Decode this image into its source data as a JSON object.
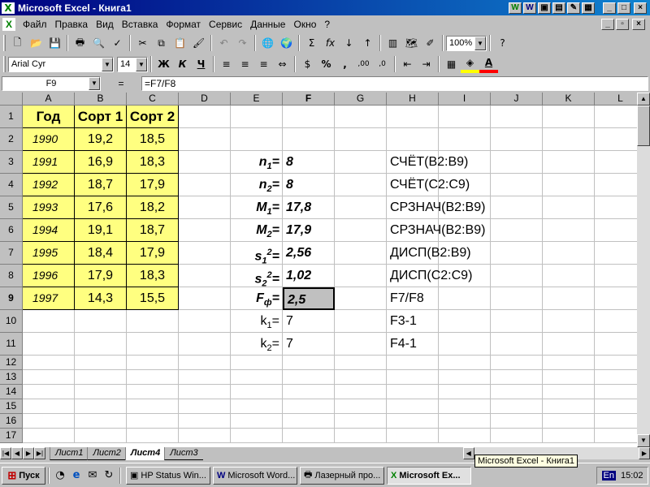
{
  "window": {
    "title": "Microsoft Excel - Книга1",
    "app_icon": "X",
    "ql_icons": [
      "W",
      "W",
      "▣",
      "▤",
      "✎",
      "▦"
    ],
    "min_label": "_",
    "max_label": "□",
    "close_label": "×",
    "doc_min_label": "_",
    "doc_max_label": "▫",
    "doc_close_label": "×"
  },
  "menu": [
    "Файл",
    "Правка",
    "Вид",
    "Вставка",
    "Формат",
    "Сервис",
    "Данные",
    "Окно",
    "?"
  ],
  "toolbar_standard": {
    "icons": [
      "new-icon",
      "open-icon",
      "save-icon",
      "print-icon",
      "preview-icon",
      "spell-icon",
      "cut-icon",
      "copy-icon",
      "paste-icon",
      "format-painter-icon",
      "undo-icon",
      "redo-icon",
      "hyperlink-icon",
      "web-icon",
      "autosum-icon",
      "function-icon",
      "sort-asc-icon",
      "sort-desc-icon",
      "chart-icon",
      "map-icon",
      "drawing-icon",
      "help-icon"
    ],
    "glyphs": [
      "🗋",
      "📂",
      "💾",
      "🖶",
      "🔍",
      "✓",
      "✂",
      "⧉",
      "📋",
      "🖌",
      "↶",
      "↷",
      "🌐",
      "🌍",
      "Σ",
      "fx",
      "↓",
      "↑",
      "▥",
      "🗺",
      "✐",
      "?"
    ],
    "zoom": "100%"
  },
  "toolbar_format": {
    "font": "Arial Cyr",
    "size": "14",
    "bold": "Ж",
    "italic": "К",
    "underline": "Ч",
    "align_glyphs": [
      "≡",
      "≡",
      "≡",
      "⇔"
    ],
    "misc_glyphs": [
      "$",
      "%",
      ",",
      ",00",
      ",0",
      "⇤",
      "⇥",
      "▦",
      "A"
    ],
    "font_color": "#ff0000",
    "fill_color": "#ffff00"
  },
  "formula_bar": {
    "name_box": "F9",
    "equals": "=",
    "formula": "=F7/F8"
  },
  "sheet": {
    "columns": [
      "A",
      "B",
      "C",
      "D",
      "E",
      "F",
      "G",
      "H",
      "I",
      "J",
      "K",
      "L"
    ],
    "rows": [
      "1",
      "2",
      "3",
      "4",
      "5",
      "6",
      "7",
      "8",
      "9",
      "10",
      "11",
      "12",
      "13",
      "14",
      "15",
      "16",
      "17"
    ],
    "table": {
      "headers": [
        "Год",
        "Сорт 1",
        "Сорт 2"
      ],
      "years": [
        "1990",
        "1991",
        "1992",
        "1993",
        "1994",
        "1995",
        "1996",
        "1997"
      ],
      "sort1": [
        "19,2",
        "16,9",
        "18,7",
        "17,6",
        "19,1",
        "18,4",
        "17,9",
        "14,3"
      ],
      "sort2": [
        "18,5",
        "18,3",
        "17,9",
        "18,2",
        "18,7",
        "17,9",
        "18,3",
        "15,5"
      ]
    },
    "stats": [
      {
        "label": "n",
        "sub": "1",
        "sup": "",
        "eq": "=",
        "value": "8",
        "formula": "СЧЁТ(B2:B9)"
      },
      {
        "label": "n",
        "sub": "2",
        "sup": "",
        "eq": "=",
        "value": "8",
        "formula": "СЧЁТ(C2:C9)"
      },
      {
        "label": "M",
        "sub": "1",
        "sup": "",
        "eq": "=",
        "value": "17,8",
        "formula": "СРЗНАЧ(B2:B9)"
      },
      {
        "label": "M",
        "sub": "2",
        "sup": "",
        "eq": "=",
        "value": "17,9",
        "formula": "СРЗНАЧ(B2:B9)"
      },
      {
        "label": "s",
        "sub": "1",
        "sup": "2",
        "eq": "=",
        "value": "2,56",
        "formula": "ДИСП(B2:B9)"
      },
      {
        "label": "s",
        "sub": "2",
        "sup": "2",
        "eq": "=",
        "value": "1,02",
        "formula": "ДИСП(C2:C9)"
      },
      {
        "label": "F",
        "sub": "ф",
        "sup": "",
        "eq": "=",
        "value": "2,5",
        "formula": "F7/F8"
      },
      {
        "label": "k",
        "sub": "1",
        "sup": "",
        "eq": "=",
        "value": "7",
        "formula": "F3-1"
      },
      {
        "label": "k",
        "sub": "2",
        "sup": "",
        "eq": "=",
        "value": "7",
        "formula": "F4-1"
      }
    ],
    "table_fill": "#ffff80",
    "selected_fill": "#c0c0c0"
  },
  "tabs": [
    "Лист1",
    "Лист2",
    "Лист4",
    "Лист3"
  ],
  "active_tab": "Лист4",
  "tooltip": "Microsoft Excel - Книга1",
  "taskbar": {
    "start": "Пуск",
    "ql_glyphs": [
      "◔",
      "e",
      "✉",
      "↻"
    ],
    "tasks": [
      "HP Status Win...",
      "Microsoft Word...",
      "Лазерный про...",
      "Microsoft Ex..."
    ],
    "lang": "En",
    "clock": "15:02"
  }
}
